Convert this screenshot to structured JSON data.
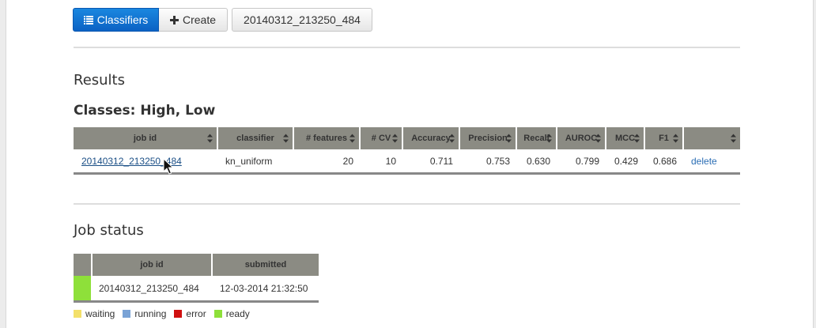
{
  "toolbar": {
    "classifiers_label": "Classifiers",
    "create_label": "Create",
    "job_label": "20140312_213250_484"
  },
  "results": {
    "heading": "Results",
    "classes_heading": "Classes: High, Low",
    "columns": [
      "job id",
      "classifier",
      "# features",
      "# CV",
      "Accuracy",
      "Precision",
      "Recall",
      "AUROC",
      "MCC",
      "F1",
      ""
    ],
    "rows": [
      {
        "job_id": "20140312_213250_484",
        "classifier": "kn_uniform",
        "features": "20",
        "cv": "10",
        "accuracy": "0.711",
        "precision": "0.753",
        "recall": "0.630",
        "auroc": "0.799",
        "mcc": "0.429",
        "f1": "0.686",
        "action": "delete"
      }
    ]
  },
  "job_status": {
    "heading": "Job status",
    "columns": [
      "",
      "job id",
      "submitted"
    ],
    "rows": [
      {
        "status_color": "#8ee03a",
        "job_id": "20140312_213250_484",
        "submitted": "12-03-2014 21:32:50"
      }
    ],
    "legend": [
      {
        "label": "waiting",
        "color": "#f3e06a"
      },
      {
        "label": "running",
        "color": "#7aa3d6"
      },
      {
        "label": "error",
        "color": "#d01010"
      },
      {
        "label": "ready",
        "color": "#8ee03a"
      }
    ]
  }
}
